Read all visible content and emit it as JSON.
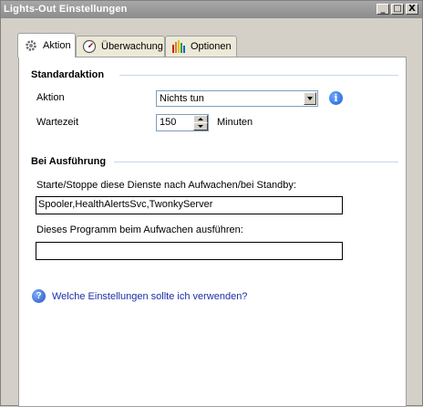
{
  "window": {
    "title": "Lights-Out Einstellungen"
  },
  "titlebar_buttons": {
    "minimize": "_",
    "maximize": "□",
    "close": "X"
  },
  "tabs": [
    {
      "label": "Aktion",
      "icon": "gear-icon",
      "active": true
    },
    {
      "label": "Überwachung",
      "icon": "gauge-icon",
      "active": false
    },
    {
      "label": "Optionen",
      "icon": "bar-chart-icon",
      "active": false
    }
  ],
  "standardaktion": {
    "title": "Standardaktion",
    "aktion_label": "Aktion",
    "aktion_value": "Nichts tun",
    "wartezeit_label": "Wartezeit",
    "wartezeit_value": "150",
    "wartezeit_unit": "Minuten"
  },
  "ausfuehrung": {
    "title": "Bei Ausführung",
    "services_label": "Starte/Stoppe diese Dienste nach Aufwachen/bei Standby:",
    "services_value": "Spooler,HealthAlertsSvc,TwonkyServer",
    "program_label": "Dieses Programm beim Aufwachen ausführen:",
    "program_value": ""
  },
  "help": {
    "link_text": "Welche Einstellungen sollte ich verwenden?",
    "icon_glyph": "?"
  },
  "info": {
    "icon_glyph": "i"
  },
  "colors": {
    "titlebar": "#8c8c8c",
    "section_line": "#c6d8ea",
    "link": "#1a2fa8",
    "info_blue": "#1f5fcf"
  }
}
